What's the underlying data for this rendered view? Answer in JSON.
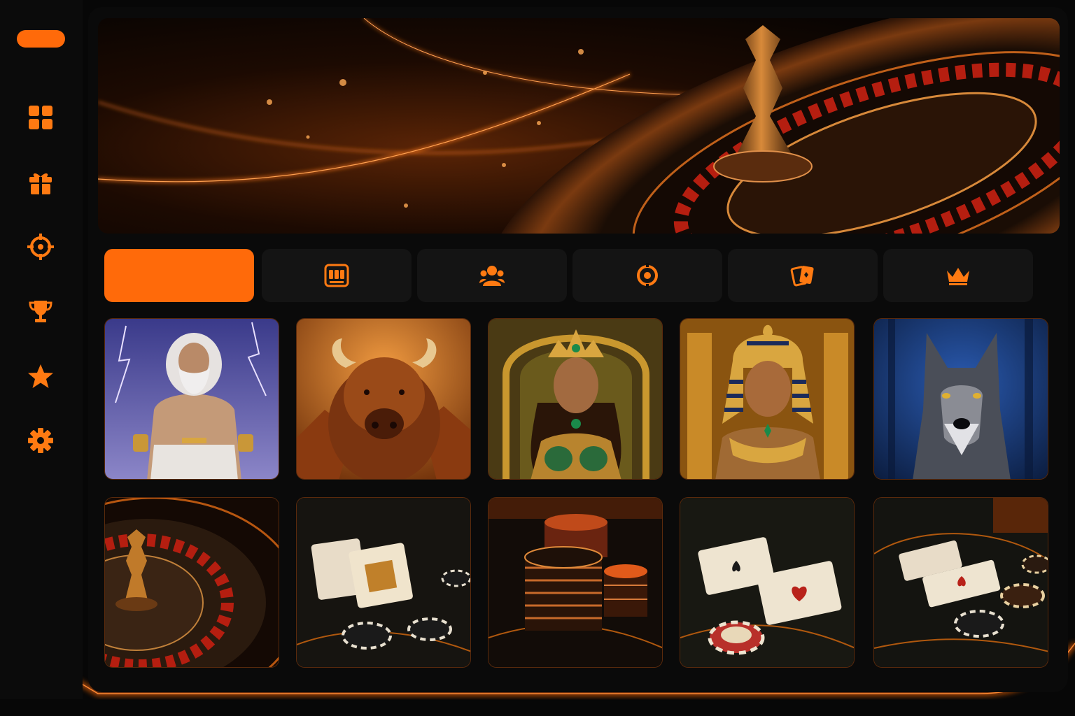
{
  "app": {
    "accent_color": "#ff6a0a",
    "background_color": "#070707"
  },
  "sidebar": {
    "items": [
      {
        "icon": "grid-icon"
      },
      {
        "icon": "gift-icon"
      },
      {
        "icon": "crosshair-icon"
      },
      {
        "icon": "trophy-icon"
      },
      {
        "icon": "star-icon"
      },
      {
        "icon": "gear-icon"
      }
    ]
  },
  "banner": {
    "subject": "roulette-wheel"
  },
  "category_tabs": [
    {
      "icon": "none",
      "active": true
    },
    {
      "icon": "slot-machine-icon",
      "active": false
    },
    {
      "icon": "live-dealers-icon",
      "active": false
    },
    {
      "icon": "roulette-icon",
      "active": false
    },
    {
      "icon": "cards-icon",
      "active": false
    },
    {
      "icon": "crown-icon",
      "active": false
    }
  ],
  "game_tiles": {
    "row1": [
      {
        "subject": "zeus-lightning"
      },
      {
        "subject": "buffalo"
      },
      {
        "subject": "golden-queen"
      },
      {
        "subject": "pharaoh"
      },
      {
        "subject": "wolf"
      }
    ],
    "row2": [
      {
        "subject": "roulette"
      },
      {
        "subject": "blackjack-cards"
      },
      {
        "subject": "poker-chips"
      },
      {
        "subject": "playing-cards"
      },
      {
        "subject": "baccarat-table"
      }
    ]
  }
}
